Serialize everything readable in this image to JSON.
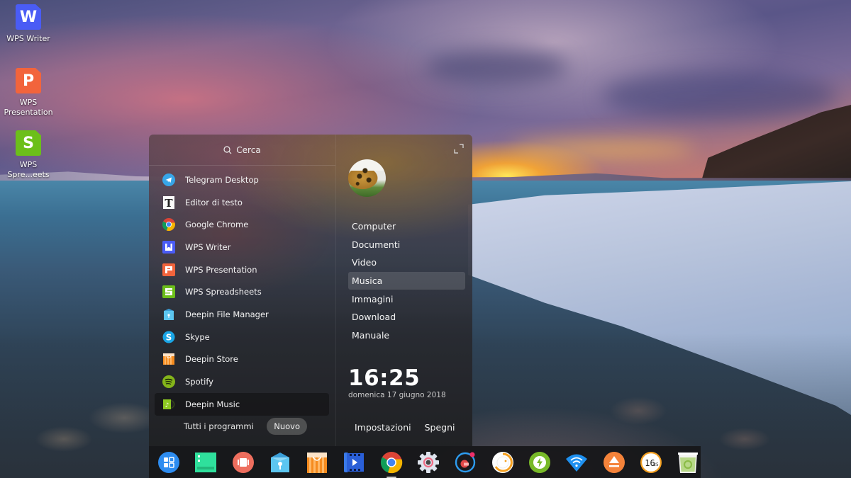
{
  "desktop": {
    "icons": [
      {
        "name": "WPS Writer",
        "icon": "wps-writer-icon",
        "color": "#4a5cf5",
        "glyph": "W"
      },
      {
        "name": "WPS\nPresentation",
        "icon": "wps-presentation-icon",
        "color": "#f2643c",
        "glyph": "P"
      },
      {
        "name": "WPS\nSpre...eets",
        "icon": "wps-spreadsheets-icon",
        "color": "#6cbf1a",
        "glyph": "S"
      }
    ]
  },
  "launcher": {
    "search_placeholder": "Cerca",
    "apps": [
      {
        "label": "Telegram Desktop",
        "icon": "telegram-icon"
      },
      {
        "label": "Editor di testo",
        "icon": "text-editor-icon"
      },
      {
        "label": "Google Chrome",
        "icon": "chrome-icon"
      },
      {
        "label": "WPS Writer",
        "icon": "wps-writer-icon"
      },
      {
        "label": "WPS Presentation",
        "icon": "wps-presentation-icon"
      },
      {
        "label": "WPS Spreadsheets",
        "icon": "wps-spreadsheets-icon"
      },
      {
        "label": "Deepin File Manager",
        "icon": "file-manager-icon"
      },
      {
        "label": "Skype",
        "icon": "skype-icon"
      },
      {
        "label": "Deepin Store",
        "icon": "deepin-store-icon"
      },
      {
        "label": "Spotify",
        "icon": "spotify-icon"
      },
      {
        "label": "Deepin Music",
        "icon": "deepin-music-icon",
        "selected": true
      }
    ],
    "all_programs_label": "Tutti i programmi",
    "new_button_label": "Nuovo",
    "places": [
      {
        "label": "Computer"
      },
      {
        "label": "Documenti"
      },
      {
        "label": "Video"
      },
      {
        "label": "Musica",
        "selected": true
      },
      {
        "label": "Immagini"
      },
      {
        "label": "Download"
      },
      {
        "label": "Manuale"
      }
    ],
    "clock": {
      "time": "16:25",
      "date": "domenica 17 giugno 2018"
    },
    "settings_label": "Impostazioni",
    "shutdown_label": "Spegni"
  },
  "dock": {
    "items": [
      {
        "name": "launcher",
        "icon": "launcher-icon"
      },
      {
        "name": "multitasking-view",
        "icon": "multitasking-icon"
      },
      {
        "name": "screen-recorder",
        "icon": "screen-recorder-icon"
      },
      {
        "name": "file-manager",
        "icon": "file-manager-icon"
      },
      {
        "name": "deepin-store",
        "icon": "deepin-store-icon"
      },
      {
        "name": "movie-player",
        "icon": "movie-player-icon"
      },
      {
        "name": "google-chrome",
        "icon": "chrome-icon",
        "running": true
      },
      {
        "name": "control-center",
        "icon": "settings-gear-icon"
      },
      {
        "name": "notifications",
        "icon": "notification-center-icon"
      },
      {
        "name": "volume",
        "icon": "volume-knob-icon"
      },
      {
        "name": "power",
        "icon": "power-bolt-icon"
      },
      {
        "name": "network",
        "icon": "wifi-icon"
      },
      {
        "name": "eject-device",
        "icon": "eject-icon"
      },
      {
        "name": "clock",
        "icon": "clock-icon",
        "text_hour": "16",
        "text_min": "25"
      },
      {
        "name": "trash",
        "icon": "trash-icon"
      }
    ]
  }
}
